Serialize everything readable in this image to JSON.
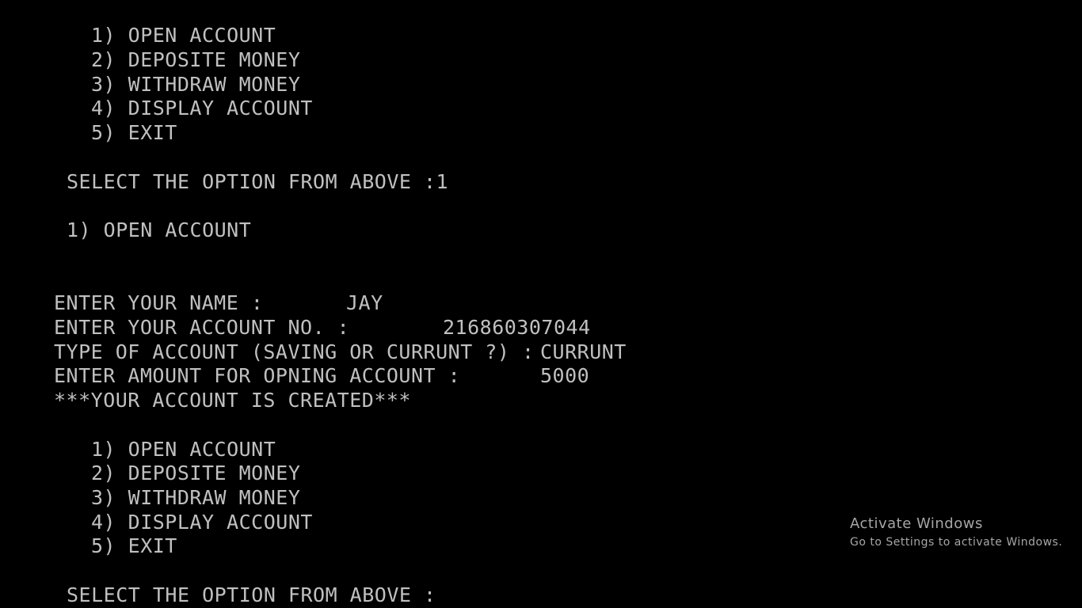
{
  "console": {
    "text_color": "#c0c0c0",
    "background_color": "#000000",
    "menu_1": [
      "1) OPEN ACCOUNT",
      "2) DEPOSITE MONEY",
      "3) WITHDRAW MONEY",
      "4) DISPLAY ACCOUNT",
      "5) EXIT"
    ],
    "prompt_1": "SELECT THE OPTION FROM ABOVE :1",
    "selected_option_header": "1) OPEN ACCOUNT",
    "form": {
      "name_label": "ENTER YOUR NAME :",
      "name_value": "JAY",
      "account_no_label": "ENTER YOUR ACCOUNT NO. :",
      "account_no_value": "216860307044",
      "account_type_label": "TYPE OF ACCOUNT (SAVING OR CURRUNT ?) :",
      "account_type_value": "CURRUNT",
      "amount_label": "ENTER AMOUNT FOR OPNING ACCOUNT :",
      "amount_value": "5000"
    },
    "created_message": "***YOUR ACCOUNT IS CREATED***",
    "menu_2": [
      "1) OPEN ACCOUNT",
      "2) DEPOSITE MONEY",
      "3) WITHDRAW MONEY",
      "4) DISPLAY ACCOUNT",
      "5) EXIT"
    ],
    "prompt_2": "SELECT THE OPTION FROM ABOVE :"
  },
  "watermark": {
    "title": "Activate Windows",
    "subtitle": "Go to Settings to activate Windows.",
    "color": "#a6a6a6"
  }
}
